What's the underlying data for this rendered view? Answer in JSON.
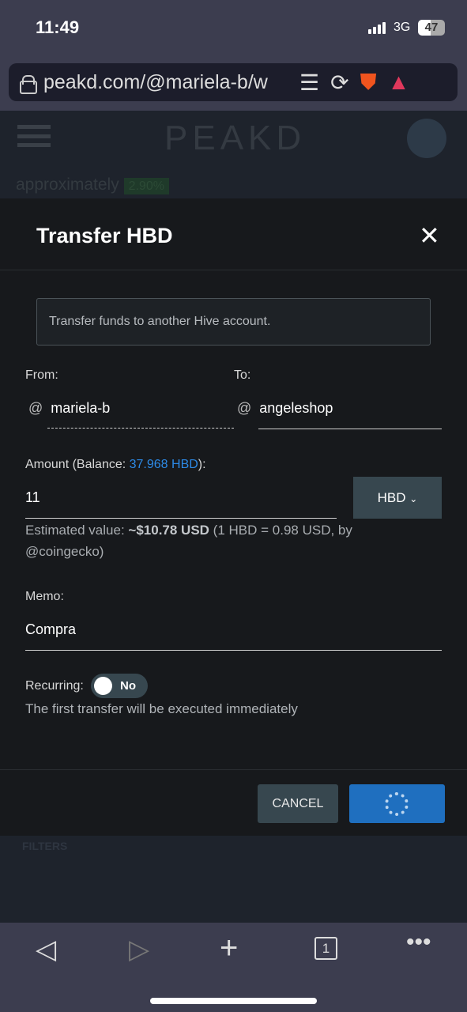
{
  "status_bar": {
    "time": "11:49",
    "network": "3G",
    "battery": "47"
  },
  "browser": {
    "url": "peakd.com/@mariela-b/w",
    "icons": [
      "lock-icon",
      "reader-icon",
      "reload-icon",
      "brave-shield-icon",
      "bat-rewards-icon"
    ]
  },
  "background_page": {
    "logo": "PEAKD",
    "approx_text": "approximately",
    "approx_value": "2.90%",
    "filters": "FILTERS"
  },
  "modal": {
    "title": "Transfer HBD",
    "info": "Transfer funds to another Hive account.",
    "from_label": "From:",
    "from_value": "mariela-b",
    "to_label": "To:",
    "to_value": "angeleshop",
    "at": "@",
    "amount_label_prefix": "Amount (Balance: ",
    "balance": "37.968 HBD",
    "amount_label_suffix": "):",
    "amount_value": "11",
    "currency": "HBD",
    "est_prefix": "Estimated value: ",
    "est_value": "~$10.78 USD",
    "est_suffix": " (1 HBD = 0.98 USD, by @coingecko)",
    "memo_label": "Memo:",
    "memo_value": "Compra",
    "recurring_label": "Recurring:",
    "recurring_state": "No",
    "recurring_note": "The first transfer will be executed immediately",
    "cancel": "CANCEL"
  },
  "bottom_nav": {
    "tab_count": "1"
  },
  "colors": {
    "accent": "#1f6fbf",
    "balance": "#2d8ae6",
    "modal_bg": "#17191c"
  }
}
